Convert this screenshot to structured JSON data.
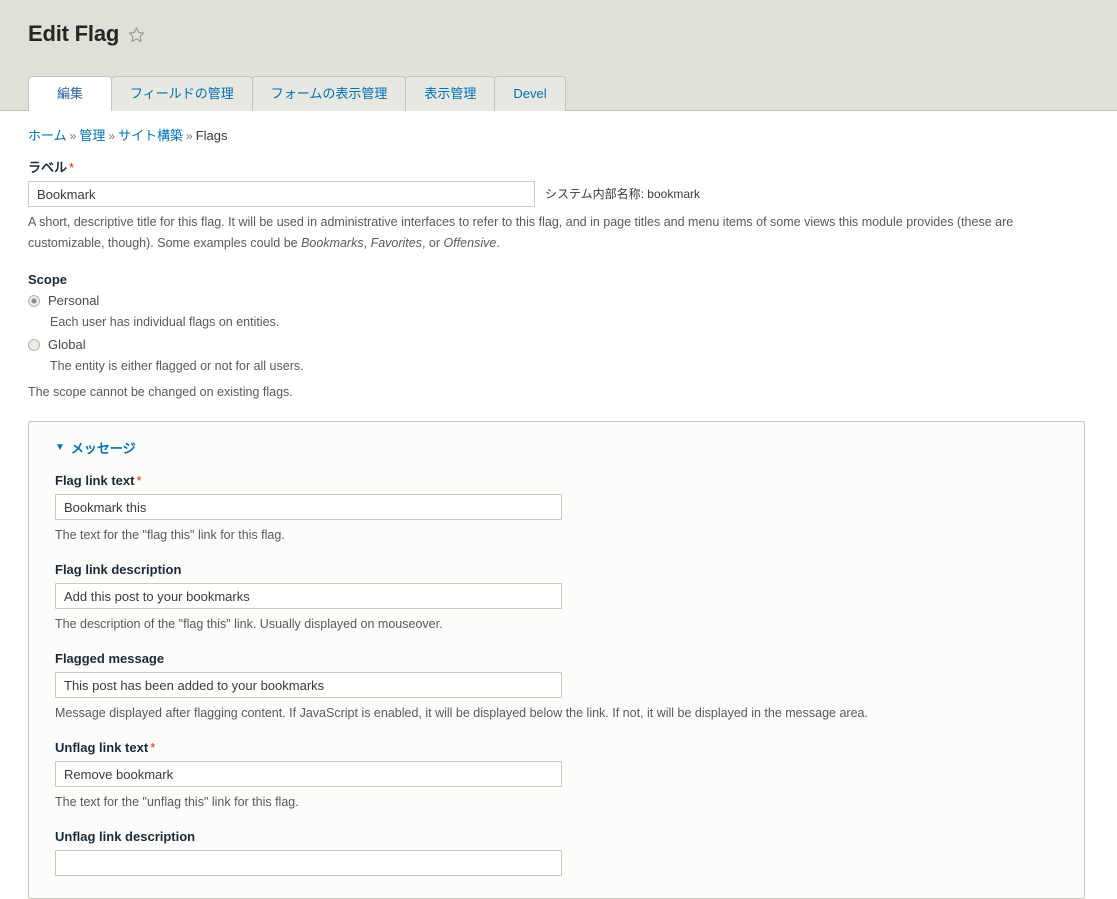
{
  "header": {
    "title": "Edit Flag",
    "star_icon": "star-outline-icon"
  },
  "tabs": [
    {
      "label": "編集",
      "active": true
    },
    {
      "label": "フィールドの管理",
      "active": false
    },
    {
      "label": "フォームの表示管理",
      "active": false
    },
    {
      "label": "表示管理",
      "active": false
    },
    {
      "label": "Devel",
      "active": false
    }
  ],
  "breadcrumb": {
    "items": [
      "ホーム",
      "管理",
      "サイト構築",
      "Flags"
    ],
    "separator": "»"
  },
  "label_field": {
    "label": "ラベル",
    "required_marker": "*",
    "value": "Bookmark",
    "machine_name": "システム内部名称: bookmark",
    "description_part1": "A short, descriptive title for this flag. It will be used in administrative interfaces to refer to this flag, and in page titles and menu items of some views this module provides (these are customizable, though). Some examples could be ",
    "description_em1": "Bookmarks",
    "description_sep1": ", ",
    "description_em2": "Favorites",
    "description_sep2": ", or ",
    "description_em3": "Offensive",
    "description_end": "."
  },
  "scope": {
    "title": "Scope",
    "options": [
      {
        "label": "Personal",
        "description": "Each user has individual flags on entities.",
        "selected": true
      },
      {
        "label": "Global",
        "description": "The entity is either flagged or not for all users.",
        "selected": false
      }
    ],
    "note": "The scope cannot be changed on existing flags."
  },
  "messages_fieldset": {
    "legend": "メッセージ",
    "arrow": "▼",
    "fields": [
      {
        "label": "Flag link text",
        "required": "*",
        "value": "Bookmark this",
        "description": "The text for the \"flag this\" link for this flag."
      },
      {
        "label": "Flag link description",
        "required": "",
        "value": "Add this post to your bookmarks",
        "description": "The description of the \"flag this\" link. Usually displayed on mouseover."
      },
      {
        "label": "Flagged message",
        "required": "",
        "value": "This post has been added to your bookmarks",
        "description": "Message displayed after flagging content. If JavaScript is enabled, it will be displayed below the link. If not, it will be displayed in the message area."
      },
      {
        "label": "Unflag link text",
        "required": "*",
        "value": "Remove bookmark",
        "description": "The text for the \"unflag this\" link for this flag."
      },
      {
        "label": "Unflag link description",
        "required": "",
        "value": "",
        "description": ""
      }
    ]
  },
  "colors": {
    "header_bg": "#e0e0d9",
    "link": "#0071b3",
    "required": "#e32700",
    "label": "#1b2a3a",
    "fieldset_bg": "#fcfcfa"
  }
}
